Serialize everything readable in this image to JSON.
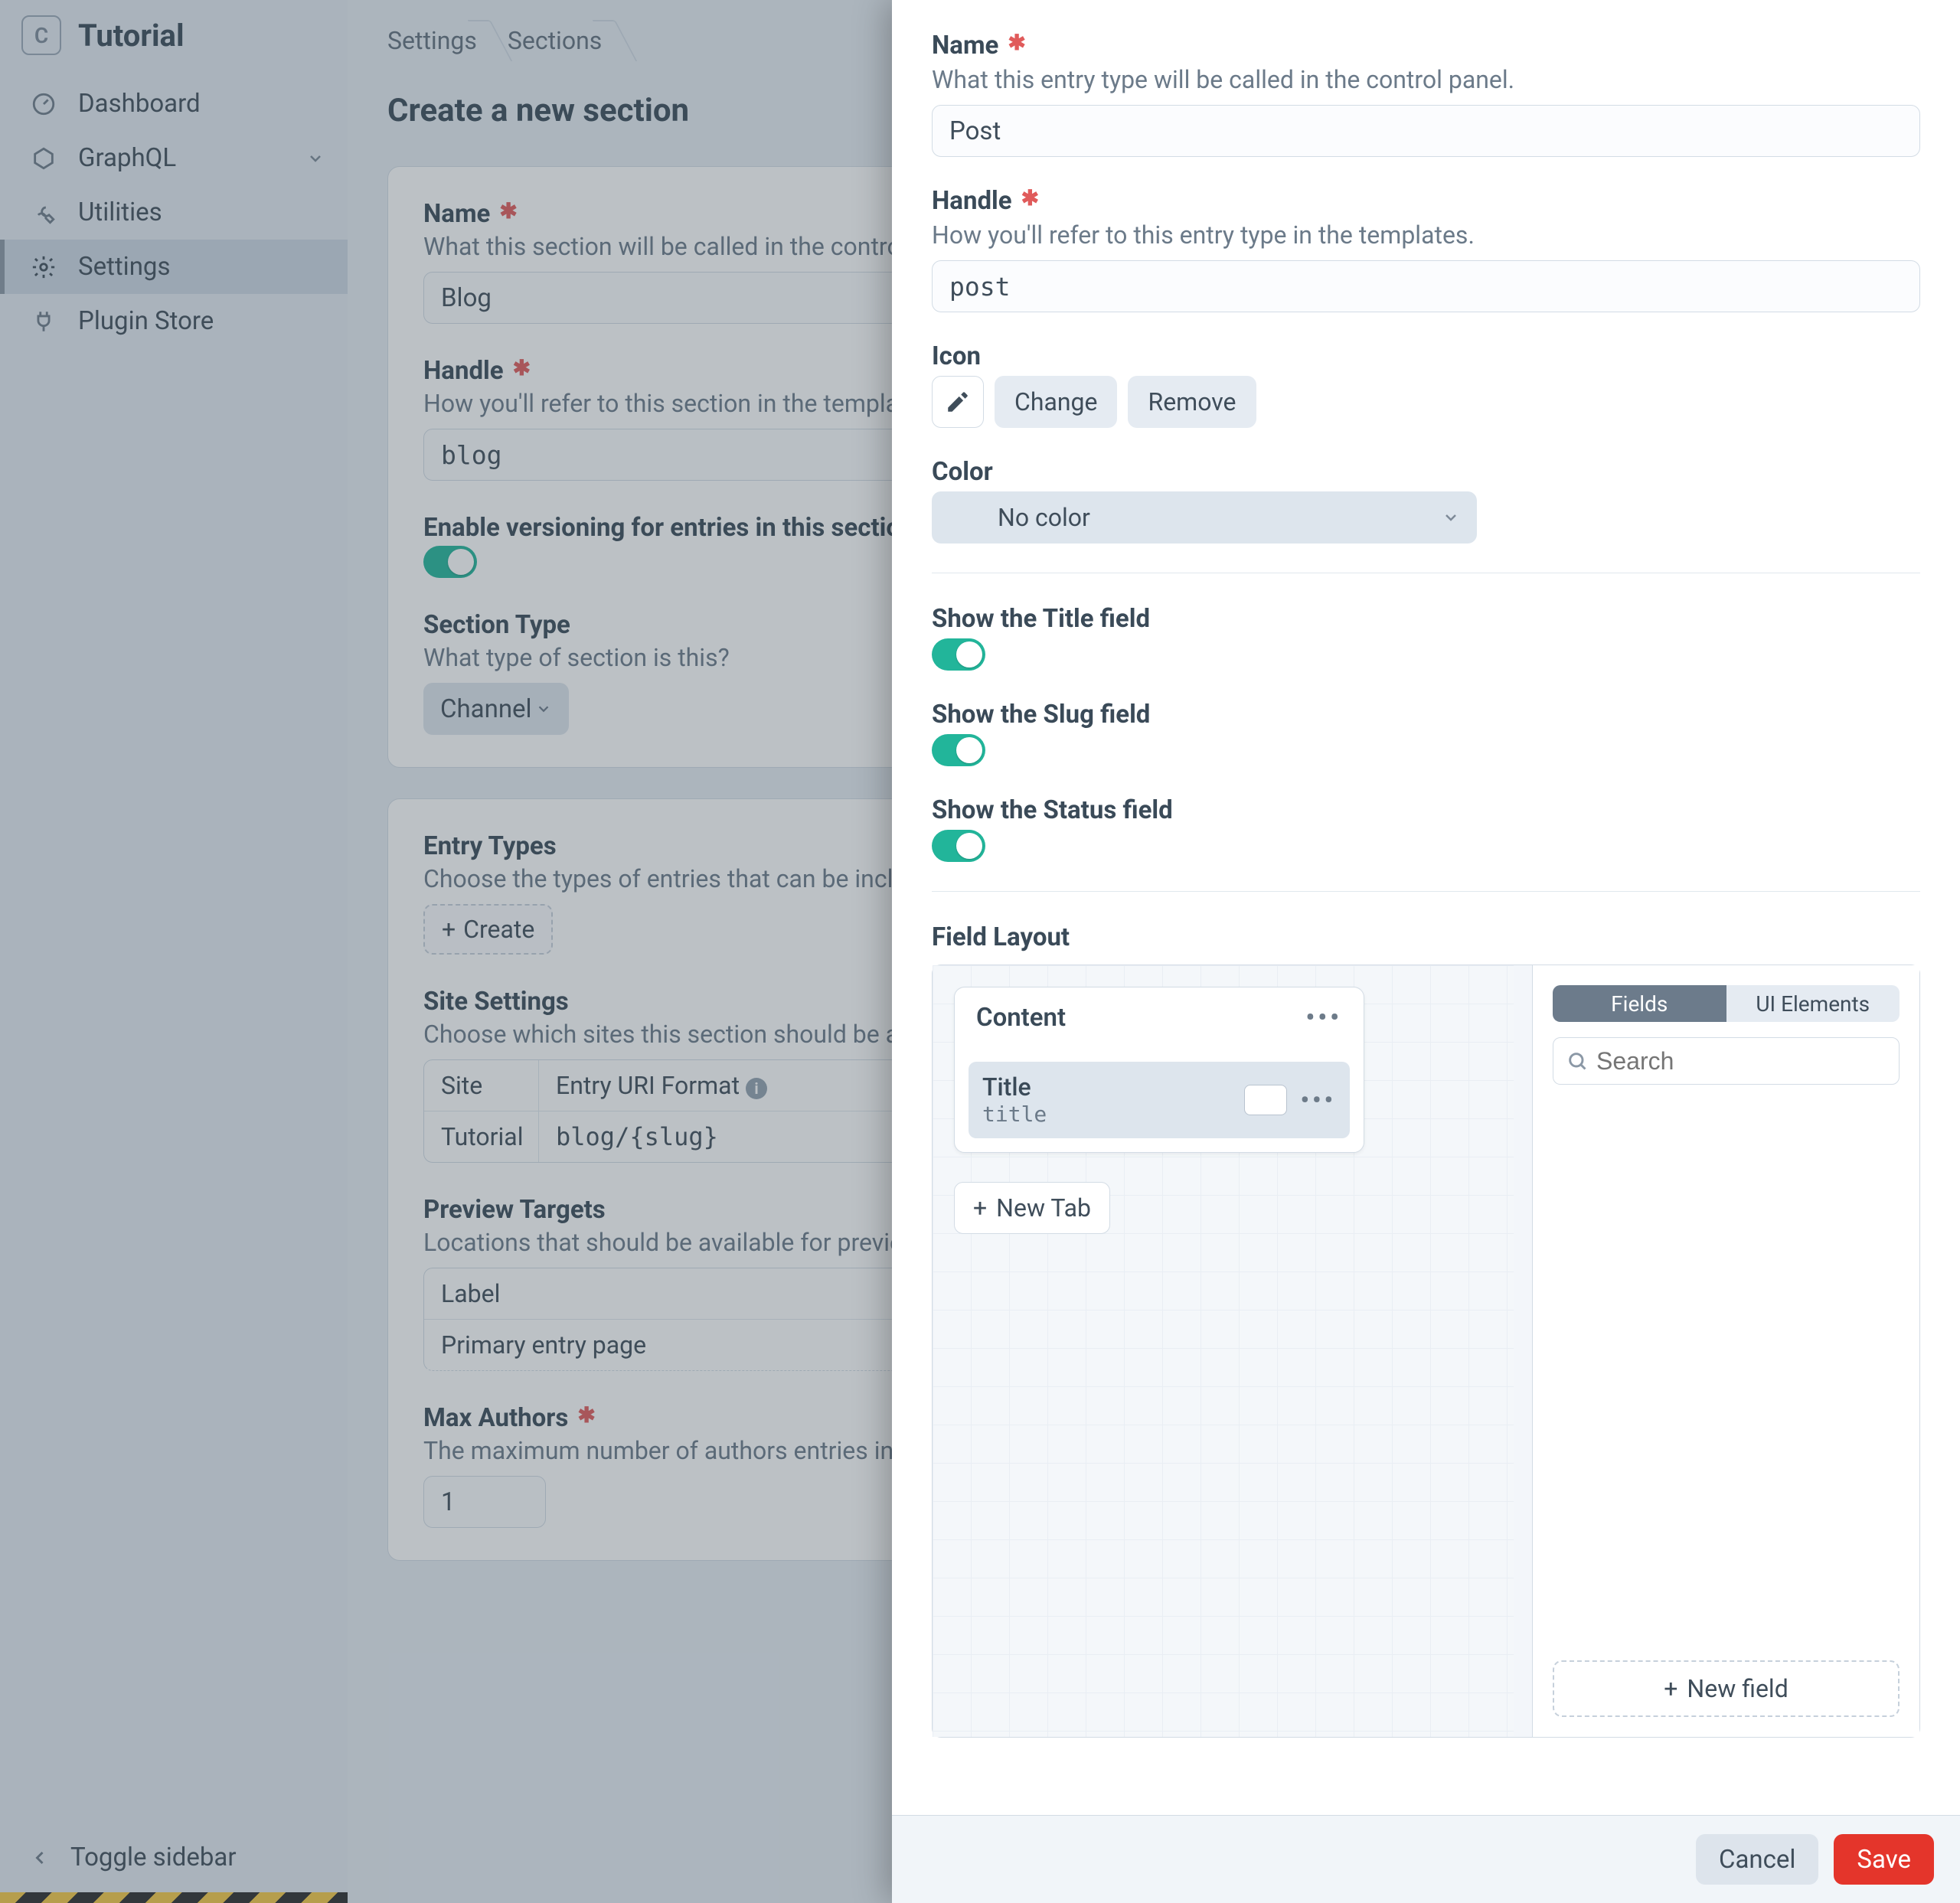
{
  "site_name": "Tutorial",
  "nav": {
    "dashboard": "Dashboard",
    "graphql": "GraphQL",
    "utilities": "Utilities",
    "settings": "Settings",
    "plugin_store": "Plugin Store"
  },
  "toggle_sidebar": "Toggle sidebar",
  "breadcrumbs": {
    "settings": "Settings",
    "sections": "Sections"
  },
  "page_heading": "Create a new section",
  "section_form": {
    "name_label": "Name",
    "name_help": "What this section will be called in the control panel.",
    "name_value": "Blog",
    "handle_label": "Handle",
    "handle_help": "How you'll refer to this section in the templates.",
    "handle_value": "blog",
    "versioning_label": "Enable versioning for entries in this section",
    "type_label": "Section Type",
    "type_help": "What type of section is this?",
    "type_value": "Channel",
    "entry_types_label": "Entry Types",
    "entry_types_help": "Choose the types of entries that can be included in this section.",
    "create_btn": "Create",
    "site_settings_label": "Site Settings",
    "site_settings_help": "Choose which sites this section should be available in.",
    "site_col": "Site",
    "uri_col": "Entry URI Format",
    "site_row_name": "Tutorial",
    "site_row_uri": "blog/{slug}",
    "preview_label": "Preview Targets",
    "preview_help": "Locations that should be available for previewing entries in this section.",
    "preview_col_label": "Label",
    "preview_row_label": "Primary entry page",
    "max_authors_label": "Max Authors",
    "max_authors_help": "The maximum number of authors entries in this section can have.",
    "max_authors_value": "1"
  },
  "slideout": {
    "name_label": "Name",
    "name_help": "What this entry type will be called in the control panel.",
    "name_value": "Post",
    "handle_label": "Handle",
    "handle_help": "How you'll refer to this entry type in the templates.",
    "handle_value": "post",
    "icon_label": "Icon",
    "change_btn": "Change",
    "remove_btn": "Remove",
    "color_label": "Color",
    "color_value": "No color",
    "show_title_label": "Show the Title field",
    "show_slug_label": "Show the Slug field",
    "show_status_label": "Show the Status field",
    "field_layout_label": "Field Layout",
    "tab_content": "Content",
    "field_title_name": "Title",
    "field_title_handle": "title",
    "new_tab": "New Tab",
    "pill_fields": "Fields",
    "pill_ui": "UI Elements",
    "search_placeholder": "Search",
    "new_field": "New field",
    "cancel": "Cancel",
    "save": "Save"
  }
}
